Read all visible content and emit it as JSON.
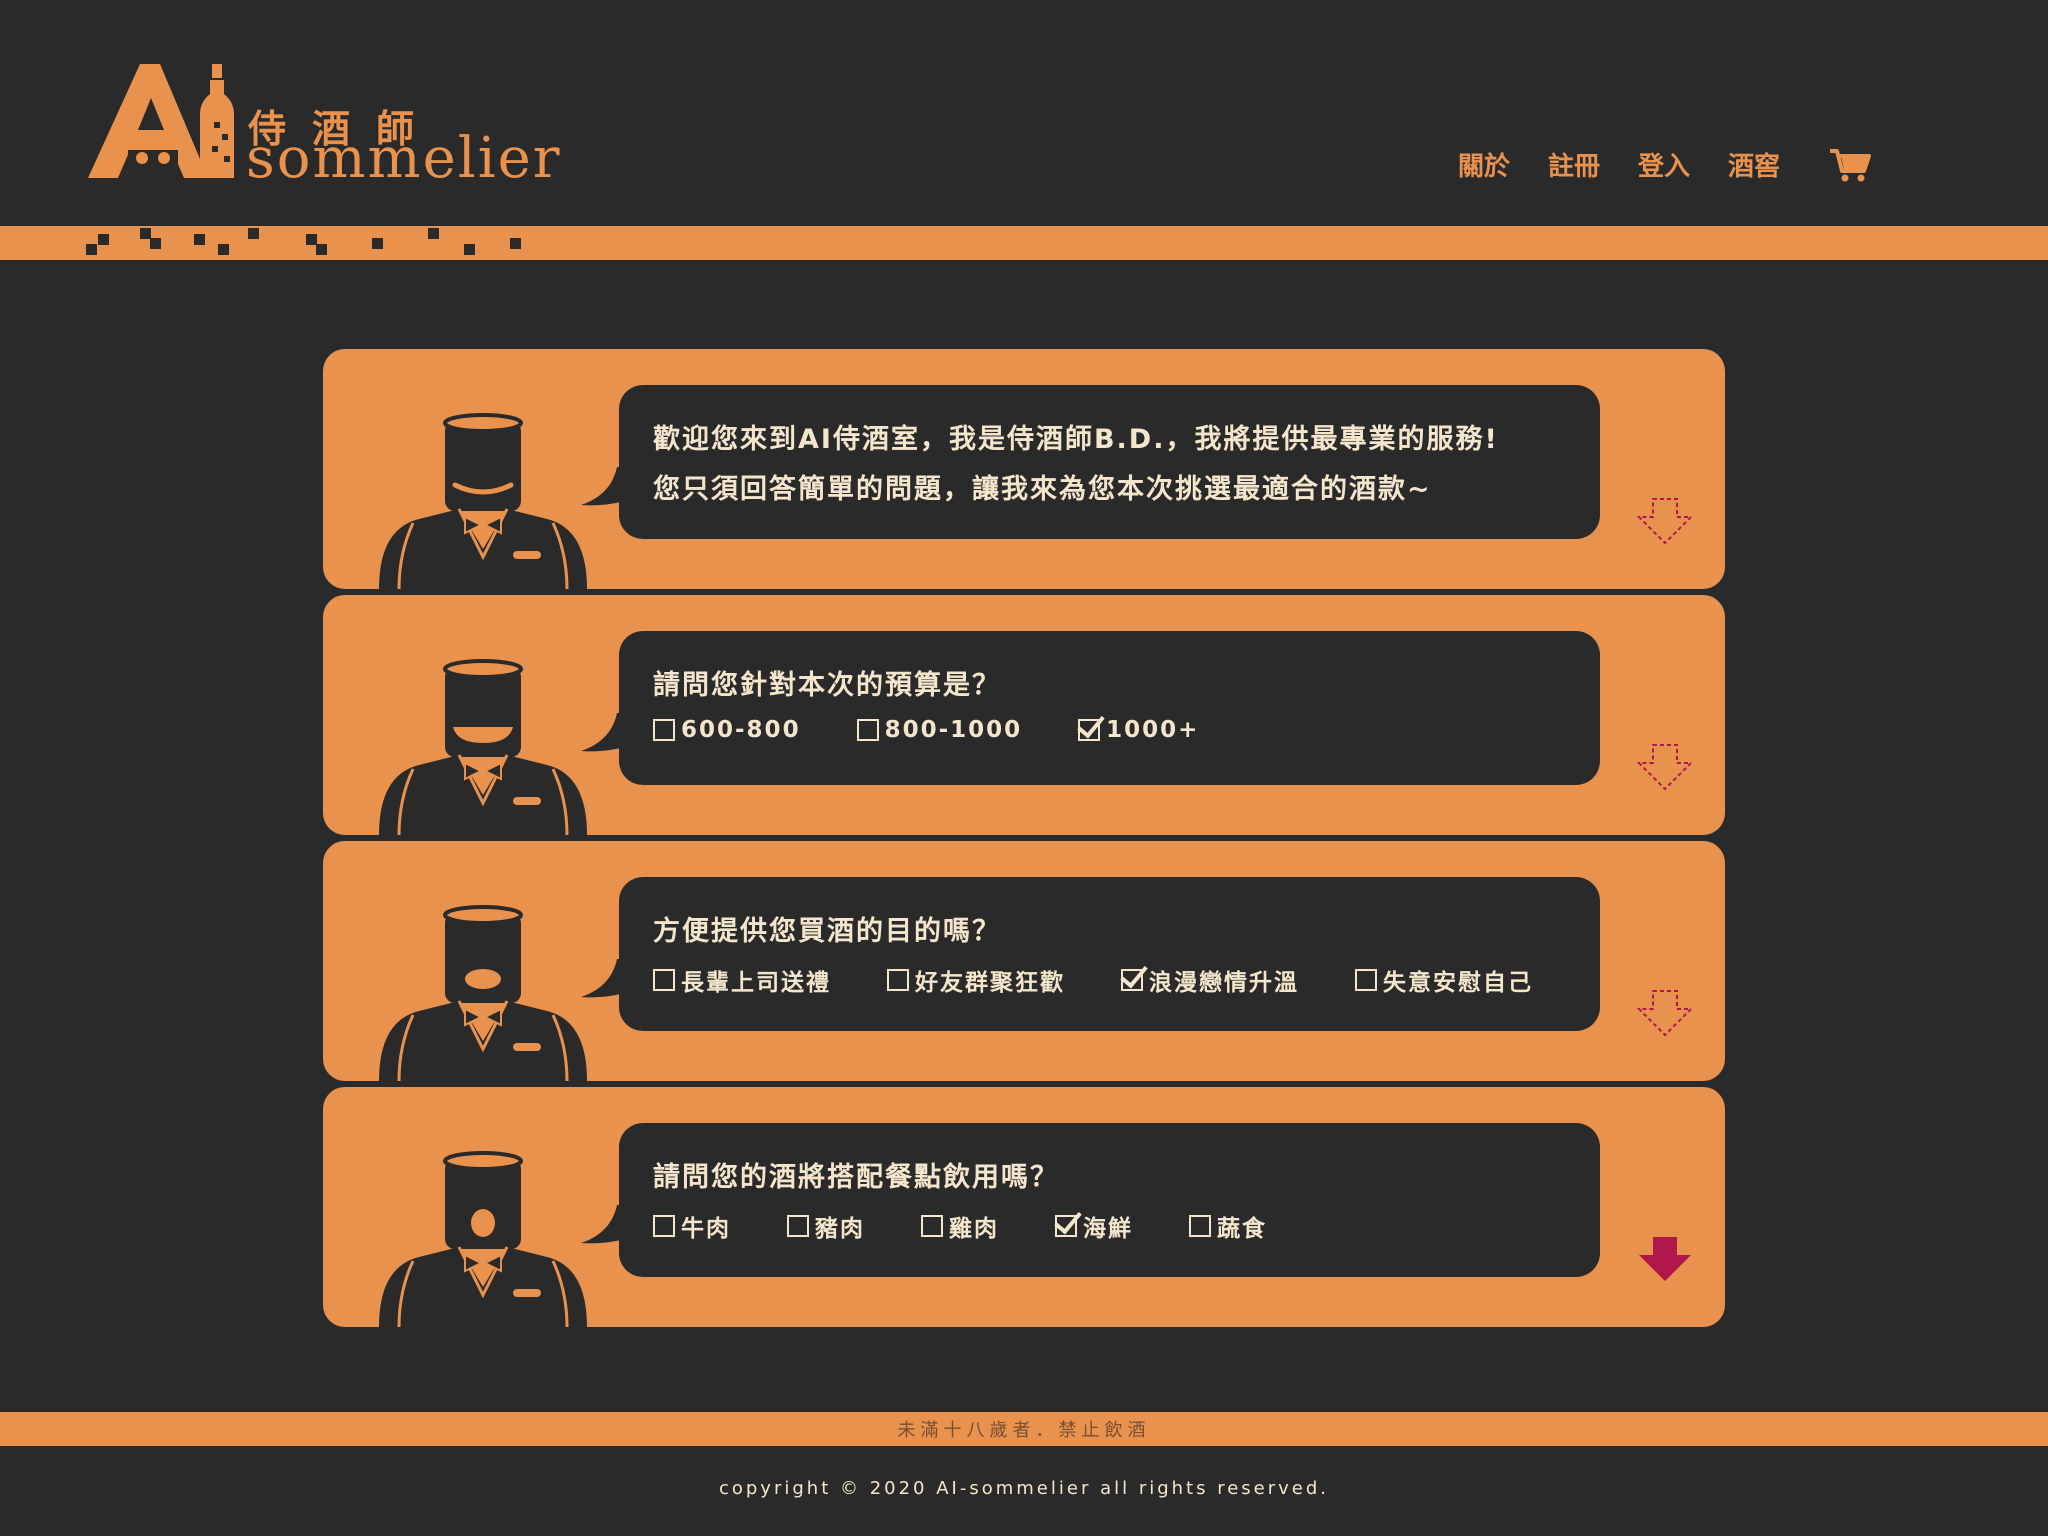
{
  "logo": {
    "mark": "Ai",
    "zh": "侍酒師",
    "en": "sommelier"
  },
  "nav": {
    "items": [
      {
        "label": "關於"
      },
      {
        "label": "註冊"
      },
      {
        "label": "登入"
      },
      {
        "label": "酒窖"
      }
    ],
    "cart_icon": "cart-icon"
  },
  "colors": {
    "background": "#2b2a2b",
    "accent": "#e8924d",
    "text_light": "#f4e6cc",
    "arrow_active": "#b0174a"
  },
  "cards": [
    {
      "lines": [
        "歡迎您來到AI侍酒室，我是侍酒師B.D.，我將提供最專業的服務!",
        "您只須回答簡單的問題，讓我來為您本次挑選最適合的酒款~"
      ],
      "options": [],
      "mouth": "smile",
      "arrow": "outline"
    },
    {
      "lines": [
        "請問您針對本次的預算是？"
      ],
      "options": [
        {
          "label": "600-800",
          "checked": false
        },
        {
          "label": "800-1000",
          "checked": false
        },
        {
          "label": "1000+",
          "checked": true
        }
      ],
      "mouth": "wide",
      "arrow": "outline"
    },
    {
      "lines": [
        "方便提供您買酒的目的嗎？"
      ],
      "options": [
        {
          "label": "長輩上司送禮",
          "checked": false
        },
        {
          "label": "好友群聚狂歡",
          "checked": false
        },
        {
          "label": "浪漫戀情升溫",
          "checked": true
        },
        {
          "label": "失意安慰自己",
          "checked": false
        }
      ],
      "mouth": "oval",
      "arrow": "outline"
    },
    {
      "lines": [
        "請問您的酒將搭配餐點飲用嗎？"
      ],
      "options": [
        {
          "label": "牛肉",
          "checked": false
        },
        {
          "label": "豬肉",
          "checked": false
        },
        {
          "label": "雞肉",
          "checked": false
        },
        {
          "label": "海鮮",
          "checked": true
        },
        {
          "label": "蔬食",
          "checked": false
        }
      ],
      "mouth": "round",
      "arrow": "solid"
    }
  ],
  "footer": {
    "notice": "未滿十八歲者．禁止飲酒",
    "copyright": "copyright © 2020 AI-sommelier all rights reserved."
  }
}
